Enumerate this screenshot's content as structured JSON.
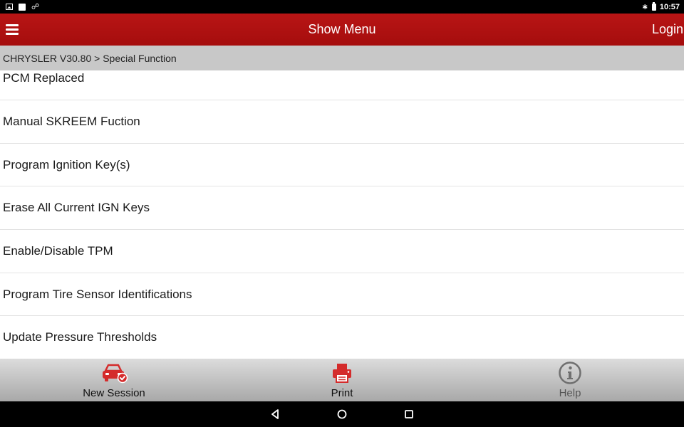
{
  "status_bar": {
    "time": "10:57",
    "left_icons": [
      "image-icon",
      "square-icon",
      "link-icon"
    ],
    "right_icons": [
      "bluetooth-icon",
      "battery-icon"
    ]
  },
  "app_bar": {
    "title": "Show Menu",
    "login_label": "Login",
    "menu_icon": "hamburger-icon"
  },
  "breadcrumb": "CHRYSLER V30.80 > Special Function",
  "list": {
    "items": [
      "PCM Replaced",
      "Manual SKREEM Fuction",
      "Program Ignition Key(s)",
      "Erase All Current IGN Keys",
      "Enable/Disable TPM",
      "Program Tire Sensor Identifications",
      "Update Pressure Thresholds"
    ]
  },
  "bottom_bar": {
    "new_session_label": "New Session",
    "print_label": "Print",
    "help_label": "Help",
    "accent_color": "#d42b2b",
    "disabled_color": "#6f6f6f"
  },
  "nav_bar": {
    "icons": [
      "back-icon",
      "home-icon",
      "recents-icon"
    ]
  }
}
